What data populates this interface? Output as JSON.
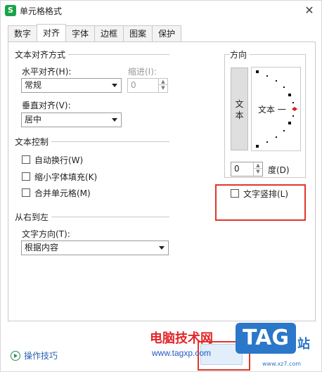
{
  "dialog": {
    "title": "单元格格式",
    "close": "✕"
  },
  "tabs": [
    {
      "label": "数字",
      "active": false
    },
    {
      "label": "对齐",
      "active": true
    },
    {
      "label": "字体",
      "active": false
    },
    {
      "label": "边框",
      "active": false
    },
    {
      "label": "图案",
      "active": false
    },
    {
      "label": "保护",
      "active": false
    }
  ],
  "text_alignment": {
    "title": "文本对齐方式",
    "horizontal_label": "水平对齐(H):",
    "horizontal_value": "常规",
    "indent_label": "缩进(I):",
    "indent_value": "0",
    "vertical_label": "垂直对齐(V):",
    "vertical_value": "居中"
  },
  "text_control": {
    "title": "文本控制",
    "wrap": "自动换行(W)",
    "shrink": "缩小字体填充(K)",
    "merge": "合并单元格(M)"
  },
  "rtl": {
    "title": "从右到左",
    "direction_label": "文字方向(T):",
    "direction_value": "根据内容"
  },
  "orientation": {
    "title": "方向",
    "vertical_char_1": "文",
    "vertical_char_2": "本",
    "dial_text": "文本 一",
    "degree_value": "0",
    "degree_label": "度(D)",
    "vertical_text_option": "文字竖排(L)"
  },
  "footer": {
    "tips": "操作技巧"
  },
  "watermark": {
    "site_name": "电脑技术网",
    "url": "www.tagxp.com",
    "logo": "TAG",
    "suffix": "站",
    "en": "www.xz7.com"
  },
  "colors": {
    "accent_red": "#e0362a",
    "app_green": "#1aa34a",
    "link_blue": "#2a62b0",
    "logo_blue": "#2b77c9"
  }
}
